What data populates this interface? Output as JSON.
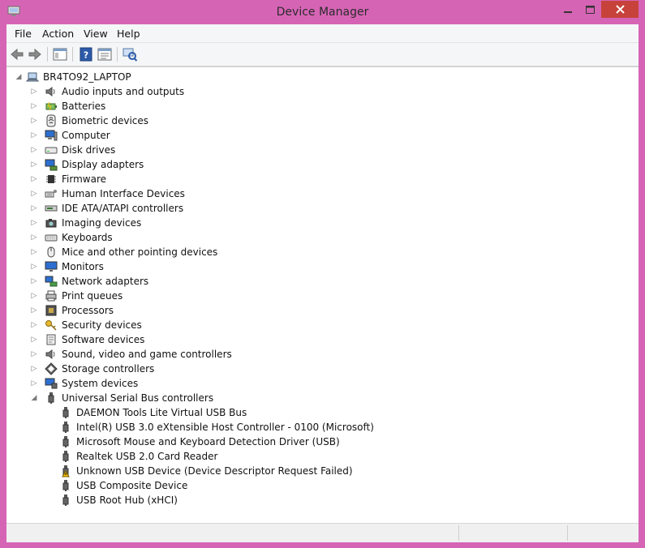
{
  "window": {
    "title": "Device Manager"
  },
  "menu": [
    {
      "label": "File"
    },
    {
      "label": "Action"
    },
    {
      "label": "View"
    },
    {
      "label": "Help"
    }
  ],
  "tree": {
    "root": "BR4TO92_LAPTOP",
    "categories": [
      {
        "label": "Audio inputs and outputs",
        "icon": "speaker-icon"
      },
      {
        "label": "Batteries",
        "icon": "battery-icon"
      },
      {
        "label": "Biometric devices",
        "icon": "fingerprint-icon"
      },
      {
        "label": "Computer",
        "icon": "computer-icon"
      },
      {
        "label": "Disk drives",
        "icon": "disk-drive-icon"
      },
      {
        "label": "Display adapters",
        "icon": "display-adapter-icon"
      },
      {
        "label": "Firmware",
        "icon": "chip-icon"
      },
      {
        "label": "Human Interface Devices",
        "icon": "hid-icon"
      },
      {
        "label": "IDE ATA/ATAPI controllers",
        "icon": "ide-controller-icon"
      },
      {
        "label": "Imaging devices",
        "icon": "camera-icon"
      },
      {
        "label": "Keyboards",
        "icon": "keyboard-icon"
      },
      {
        "label": "Mice and other pointing devices",
        "icon": "mouse-icon"
      },
      {
        "label": "Monitors",
        "icon": "monitor-icon"
      },
      {
        "label": "Network adapters",
        "icon": "network-adapter-icon"
      },
      {
        "label": "Print queues",
        "icon": "printer-icon"
      },
      {
        "label": "Processors",
        "icon": "processor-icon"
      },
      {
        "label": "Security devices",
        "icon": "security-key-icon"
      },
      {
        "label": "Software devices",
        "icon": "software-device-icon"
      },
      {
        "label": "Sound, video and game controllers",
        "icon": "speaker-icon"
      },
      {
        "label": "Storage controllers",
        "icon": "storage-controller-icon"
      },
      {
        "label": "System devices",
        "icon": "system-device-icon"
      },
      {
        "label": "Universal Serial Bus controllers",
        "icon": "usb-icon",
        "expanded": true
      }
    ],
    "usb_children": [
      {
        "label": "DAEMON Tools Lite Virtual USB Bus",
        "warning": false
      },
      {
        "label": "Intel(R) USB 3.0 eXtensible Host Controller - 0100 (Microsoft)",
        "warning": false
      },
      {
        "label": "Microsoft Mouse and Keyboard Detection Driver (USB)",
        "warning": false
      },
      {
        "label": "Realtek USB 2.0 Card Reader",
        "warning": false
      },
      {
        "label": "Unknown USB Device (Device Descriptor Request Failed)",
        "warning": true
      },
      {
        "label": "USB Composite Device",
        "warning": false
      },
      {
        "label": "USB Root Hub (xHCI)",
        "warning": false
      }
    ]
  }
}
